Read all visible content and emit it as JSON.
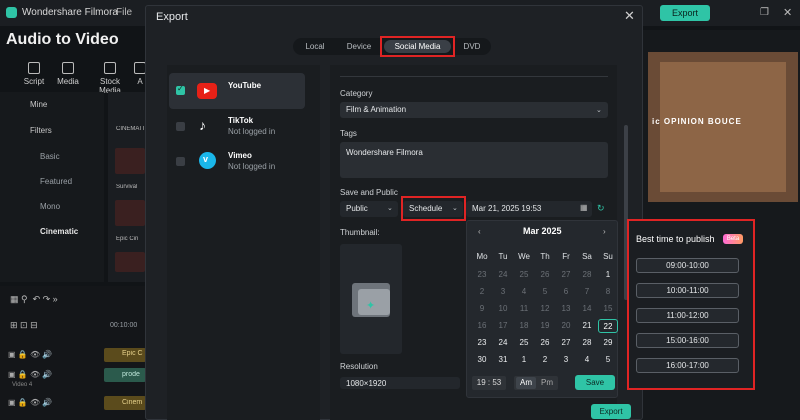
{
  "app": {
    "title": "Wondershare Filmora",
    "menu_file": "File",
    "export_label": "Export",
    "project_title": "Audio to Video"
  },
  "toolbar": [
    {
      "label": "Script",
      "icon": "script-icon"
    },
    {
      "label": "Media",
      "icon": "media-icon"
    },
    {
      "label": "Stock Media",
      "icon": "stock-media-icon"
    },
    {
      "label": "A",
      "icon": "audio-icon"
    }
  ],
  "sidebar": {
    "mine": "Mine",
    "filters": "Filters",
    "basic": "Basic",
    "featured": "Featured",
    "mono": "Mono",
    "cinematic": "Cinematic"
  },
  "bg_labels": {
    "thumbs_header": "CINEMATI",
    "survival": "Survival",
    "epic": "Epic Cin",
    "time": "00:10:00",
    "track1": "Epic C",
    "track2": "prode",
    "track3": "Cinem",
    "video4": "Video 4"
  },
  "preview": {
    "caption": "ic OPINION BOUCE"
  },
  "dialog": {
    "title": "Export",
    "tabs": [
      "Local",
      "Device",
      "Social Media",
      "DVD"
    ],
    "platforms": [
      {
        "name": "YouTube",
        "status": "",
        "checked": true
      },
      {
        "name": "TikTok",
        "status": "Not logged in",
        "checked": false
      },
      {
        "name": "Vimeo",
        "status": "Not logged in",
        "checked": false
      }
    ],
    "category_label": "Category",
    "category_value": "Film & Animation",
    "tags_label": "Tags",
    "tags_value": "Wondershare Filmora",
    "save_public_label": "Save and Public",
    "visibility_value": "Public",
    "schedule_value": "Schedule",
    "datetime_value": "Mar 21, 2025  19:53",
    "thumbnail_label": "Thumbnail:",
    "resolution_label": "Resolution",
    "resolution_value": "1080×1920",
    "export_button": "Export"
  },
  "calendar": {
    "prev": "‹",
    "next": "›",
    "month": "Mar  2025",
    "dow": [
      "Mo",
      "Tu",
      "We",
      "Th",
      "Fr",
      "Sa",
      "Su"
    ],
    "weeks": [
      [
        "23",
        "24",
        "25",
        "26",
        "27",
        "28",
        "1"
      ],
      [
        "2",
        "3",
        "4",
        "5",
        "6",
        "7",
        "8"
      ],
      [
        "9",
        "10",
        "11",
        "12",
        "13",
        "14",
        "15"
      ],
      [
        "16",
        "17",
        "18",
        "19",
        "20",
        "21",
        "22"
      ],
      [
        "23",
        "24",
        "25",
        "26",
        "27",
        "28",
        "29"
      ],
      [
        "30",
        "31",
        "1",
        "2",
        "3",
        "4",
        "5"
      ]
    ],
    "selected": "22",
    "hour": "19",
    "minute": "53",
    "am": "Am",
    "pm": "Pm",
    "save": "Save"
  },
  "best_time": {
    "title": "Best time to publish",
    "badge": "Beta",
    "slots": [
      "09:00-10:00",
      "10:00-11:00",
      "11:00-12:00",
      "15:00-16:00",
      "16:00-17:00"
    ]
  },
  "colors": {
    "accent": "#2fc4a6",
    "highlight": "#e02424",
    "youtube": "#e62117",
    "vimeo": "#1ab7ea"
  }
}
